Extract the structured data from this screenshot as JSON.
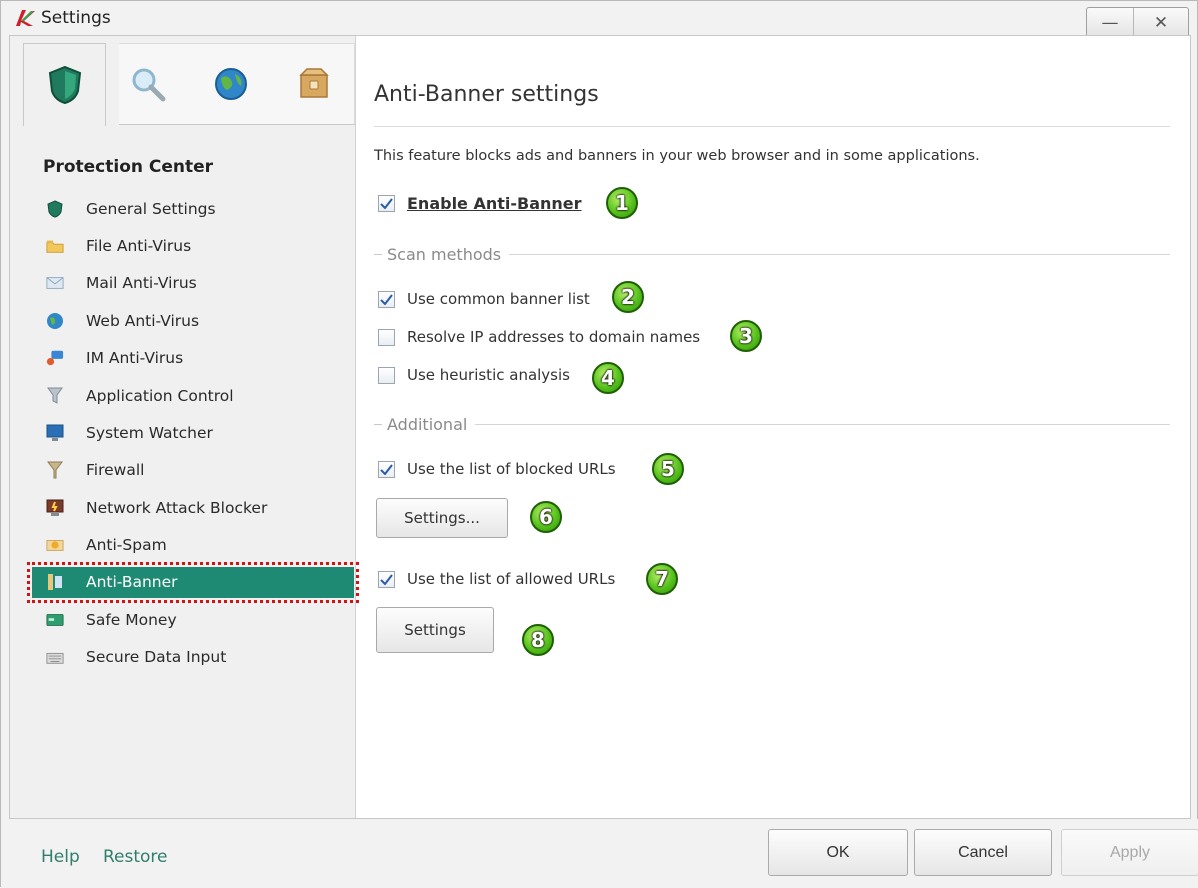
{
  "window": {
    "title": "Settings",
    "minimize": "—",
    "close": "✕"
  },
  "tabs": [
    {
      "icon": "shield-icon",
      "active": true
    },
    {
      "icon": "magnifier-icon",
      "active": false
    },
    {
      "icon": "globe-icon",
      "active": false
    },
    {
      "icon": "box-icon",
      "active": false
    }
  ],
  "sidebar": {
    "section_title": "Protection Center",
    "items": [
      {
        "label": "General Settings",
        "icon": "shield-icon"
      },
      {
        "label": "File Anti-Virus",
        "icon": "folder-icon"
      },
      {
        "label": "Mail Anti-Virus",
        "icon": "envelope-icon"
      },
      {
        "label": "Web Anti-Virus",
        "icon": "globe-icon"
      },
      {
        "label": "IM Anti-Virus",
        "icon": "chat-icon"
      },
      {
        "label": "Application Control",
        "icon": "funnel-icon"
      },
      {
        "label": "System Watcher",
        "icon": "monitor-icon"
      },
      {
        "label": "Firewall",
        "icon": "firewall-icon"
      },
      {
        "label": "Network Attack Blocker",
        "icon": "network-icon"
      },
      {
        "label": "Anti-Spam",
        "icon": "spam-icon"
      },
      {
        "label": "Anti-Banner",
        "icon": "banner-icon",
        "active": true
      },
      {
        "label": "Safe Money",
        "icon": "money-icon"
      },
      {
        "label": "Secure Data Input",
        "icon": "keyboard-icon"
      }
    ]
  },
  "main": {
    "title": "Anti-Banner settings",
    "description": "This feature blocks ads and banners in your web browser and in some applications.",
    "enable": {
      "label": "Enable Anti-Banner",
      "checked": true,
      "badge": "1"
    },
    "scan_methods": {
      "label": "Scan methods",
      "options": [
        {
          "label": "Use common banner list",
          "checked": true,
          "badge": "2"
        },
        {
          "label": "Resolve IP addresses to domain names",
          "checked": false,
          "badge": "3"
        },
        {
          "label": "Use heuristic analysis",
          "checked": false,
          "badge": "4"
        }
      ]
    },
    "additional": {
      "label": "Additional",
      "blocked": {
        "label": "Use the list of blocked URLs",
        "checked": true,
        "badge": "5"
      },
      "blocked_settings": {
        "label": "Settings...",
        "badge": "6"
      },
      "allowed": {
        "label": "Use the list of allowed URLs",
        "checked": true,
        "badge": "7"
      },
      "allowed_settings": {
        "label": "Settings",
        "badge": "8"
      }
    }
  },
  "footer": {
    "help": "Help",
    "restore": "Restore",
    "ok": "OK",
    "cancel": "Cancel",
    "apply": "Apply"
  },
  "colors": {
    "accent": "#1f8a73",
    "highlight_border": "#d01414",
    "badge": "#57c21d",
    "link": "#2f7f6a"
  }
}
